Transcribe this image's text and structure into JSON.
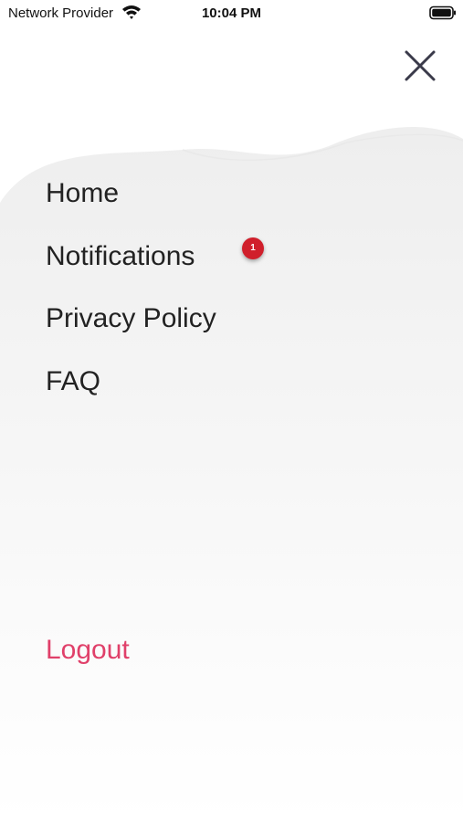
{
  "status_bar": {
    "carrier": "Network Provider",
    "time": "10:04 PM",
    "wifi_icon": "wifi-icon",
    "battery_icon": "battery-icon"
  },
  "header": {
    "close_icon": "close-icon"
  },
  "menu": {
    "items": [
      {
        "label": "Home"
      },
      {
        "label": "Notifications",
        "badge": "1"
      },
      {
        "label": "Privacy Policy"
      },
      {
        "label": "FAQ"
      }
    ],
    "logout_label": "Logout"
  },
  "colors": {
    "logout": "#e0406a",
    "badge": "#d01f2b",
    "close_icon": "#3a3a4a",
    "background_wave": "#f2f2f2"
  }
}
